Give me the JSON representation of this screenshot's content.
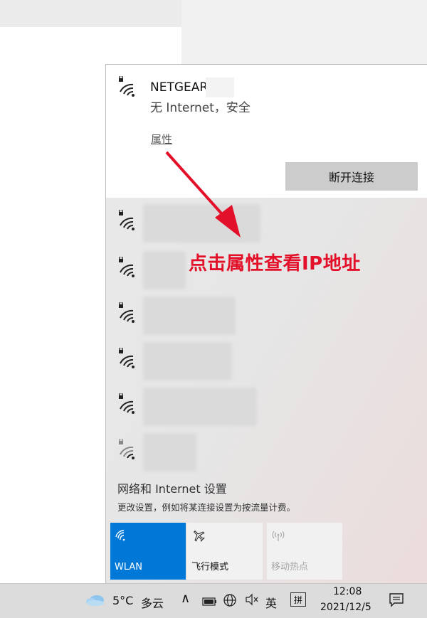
{
  "connected_network": {
    "ssid": "NETGEAR",
    "status": "无 Internet，安全",
    "properties_link": "属性",
    "disconnect_button": "断开连接"
  },
  "other_networks": [
    {
      "name": ""
    },
    {
      "name": ""
    },
    {
      "name": ""
    },
    {
      "name": ""
    },
    {
      "name": ""
    },
    {
      "name": ""
    }
  ],
  "settings": {
    "title": "网络和 Internet 设置",
    "description": "更改设置，例如将某连接设置为按流量计费。"
  },
  "quick_actions": [
    {
      "label": "WLAN",
      "icon": "wifi-icon",
      "state": "on"
    },
    {
      "label": "飞行模式",
      "icon": "airplane-icon",
      "state": "off"
    },
    {
      "label": "移动热点",
      "icon": "hotspot-icon",
      "state": "disabled"
    }
  ],
  "annotation": {
    "text": "点击属性查看IP地址",
    "color": "#e3102a"
  },
  "taskbar": {
    "temperature": "5°C",
    "condition": "多云",
    "chevron": "∧",
    "ime_language": "英",
    "ime_pad": "拼",
    "time": "12:08",
    "date": "2021/12/5"
  },
  "colors": {
    "accent": "#0078d7",
    "annotation": "#e3102a"
  }
}
